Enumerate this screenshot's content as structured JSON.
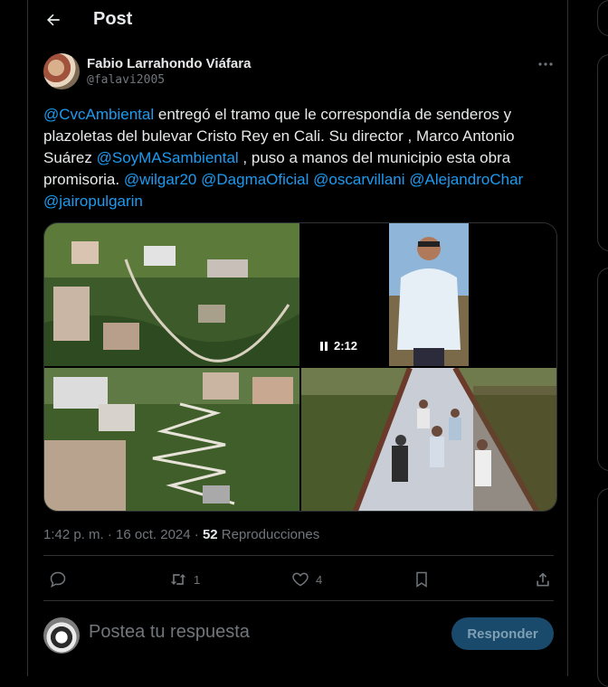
{
  "header": {
    "title": "Post"
  },
  "post": {
    "author_name": "Fabio Larrahondo Viáfara",
    "author_handle": "@falavi2005",
    "text_segments": {
      "m1": "@CvcAmbiental",
      "t1": " entregó el tramo que le correspondía de senderos y plazoletas del bulevar Cristo Rey en Cali. Su director , Marco Antonio Suárez ",
      "m2": "@SoyMASambiental",
      "t2": " , puso a manos del municipio esta obra promisoria. ",
      "m3": "@wilgar20",
      "m4": "@DagmaOficial",
      "m5": "@oscarvillani",
      "m6": "@AlejandroChar",
      "m7": "@jairopulgarin"
    },
    "video_time": "2:12",
    "timestamp": "1:42 p. m. · 16 oct. 2024 · ",
    "views_count": "52",
    "views_label": " Reproducciones"
  },
  "actions": {
    "reply_count": "",
    "repost_count": "1",
    "like_count": "4"
  },
  "reply_box": {
    "placeholder": "Postea tu respuesta",
    "button_label": "Responder"
  },
  "colors": {
    "accent": "#1d9bf0",
    "background": "#000000",
    "muted": "#71767b",
    "border": "#2f3336"
  },
  "icons": [
    "back-arrow-icon",
    "more-icon",
    "pause-icon",
    "reply-icon",
    "repost-icon",
    "like-icon",
    "bookmark-icon",
    "share-icon"
  ]
}
